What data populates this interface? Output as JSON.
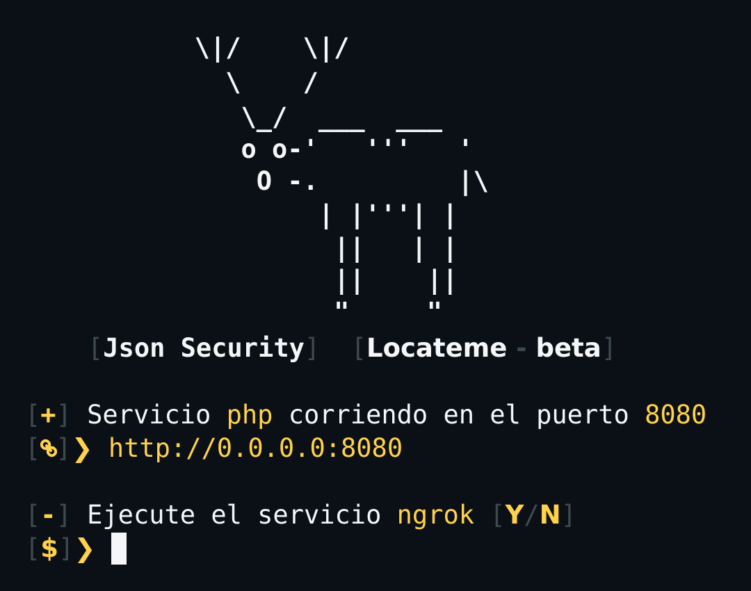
{
  "ascii_art": [
    "      \\|/    \\|/",
    "        \\    /",
    "         \\_/  ___  ___",
    "         o o-'   '''   '",
    "          O -.         |\\",
    "              | |'''| |",
    "               ||   | |",
    "               ||    ||",
    "               \"     \""
  ],
  "banner": {
    "left_bracket_1": "[",
    "author": "Json Security",
    "right_bracket_1": "]",
    "left_bracket_2": "[",
    "tool": "Locateme",
    "dash": " - ",
    "version": "beta",
    "right_bracket_2": "]"
  },
  "status_line": {
    "open": "[",
    "symbol": "+",
    "close": "]",
    "text_1": " Servicio ",
    "lang": "php",
    "text_2": " corriendo en el puerto ",
    "port": "8080"
  },
  "url_line": {
    "open": "[",
    "icon": "link-icon",
    "close": "]",
    "arrow": "❯",
    "url": "http://0.0.0.0:8080"
  },
  "question_line": {
    "open": "[",
    "symbol": "-",
    "close": "]",
    "text": " Ejecute el servicio ",
    "service": "ngrok",
    "opt_open": "[",
    "yes": "Y",
    "slash": "/",
    "no": "N",
    "opt_close": "]"
  },
  "prompt_line": {
    "open": "[",
    "symbol": "$",
    "close": "]",
    "arrow": "❯",
    "input_value": ""
  },
  "colors": {
    "background": "#0b1016",
    "foreground": "#f4f6f8",
    "accent": "#ffd24a",
    "bracket": "#3d4a4e"
  }
}
